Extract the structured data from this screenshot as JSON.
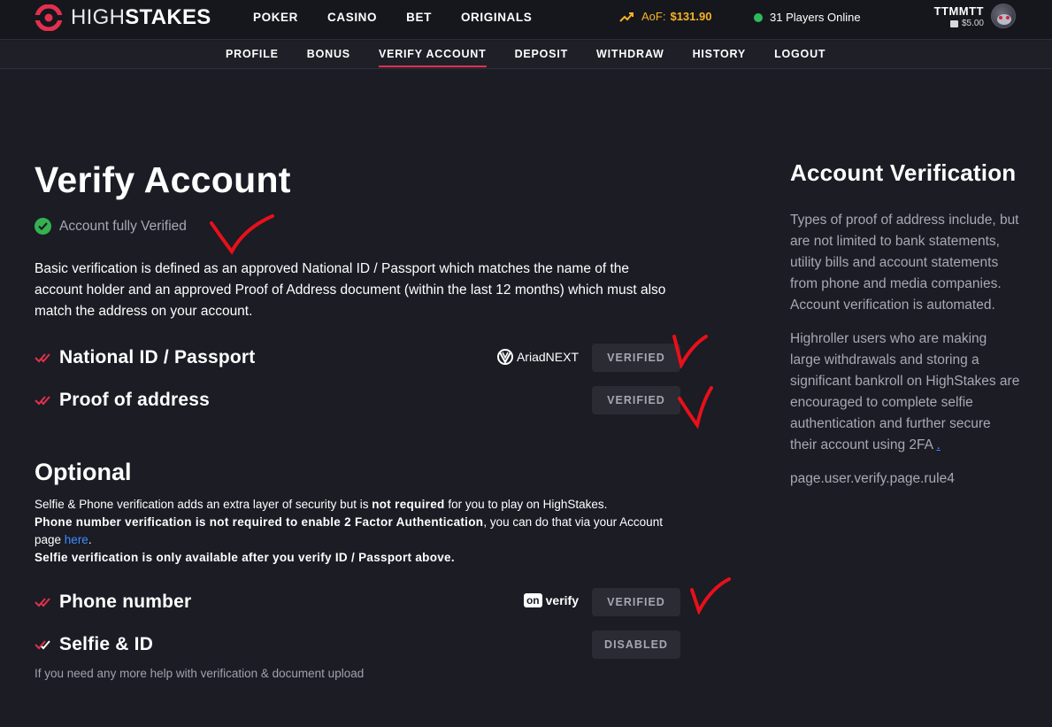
{
  "header": {
    "logo": {
      "light": "HIGH",
      "bold": "STAKES"
    },
    "nav": [
      "POKER",
      "CASINO",
      "BET",
      "ORIGINALS"
    ],
    "aof_label": "AoF:",
    "aof_amount": "$131.90",
    "players_online": "31 Players Online",
    "username": "TTMMTT",
    "balance": "$5.00"
  },
  "subnav": {
    "items": [
      "PROFILE",
      "BONUS",
      "VERIFY ACCOUNT",
      "DEPOSIT",
      "WITHDRAW",
      "HISTORY",
      "LOGOUT"
    ],
    "active": "VERIFY ACCOUNT"
  },
  "main": {
    "title": "Verify Account",
    "status": "Account fully Verified",
    "intro": "Basic verification is defined as an approved National ID / Passport which matches the name of the account holder and an approved Proof of Address document (within the last 12 months) which must also match the address on your account.",
    "requirements": [
      {
        "label": "National ID / Passport",
        "provider": "AriadNEXT",
        "status": "VERIFIED"
      },
      {
        "label": "Proof of address",
        "provider": "",
        "status": "VERIFIED"
      }
    ],
    "optional": {
      "title": "Optional",
      "line1_pre": "Selfie & Phone verification adds an extra layer of security but is ",
      "line1_bold": "not required",
      "line1_post": " for you to play on HighStakes.",
      "line2_bold": "Phone number verification is not required to enable 2 Factor Authentication",
      "line2_post": ", you can do that via your Account page ",
      "line2_link": "here",
      "line2_end": ".",
      "line3_bold": "Selfie verification is only available after you verify ID / Passport above.",
      "items": [
        {
          "label": "Phone number",
          "provider_badge": "on",
          "provider_text": "verify",
          "status": "VERIFIED"
        },
        {
          "label": "Selfie & ID",
          "status": "DISABLED"
        }
      ]
    },
    "help": "If you need any more help with verification & document upload"
  },
  "side": {
    "title": "Account Verification",
    "p1": "Types of proof of address include, but are not limited to bank statements, utility bills and account statements from phone and media companies. Account verification is automated.",
    "p2": "Highroller users who are making large withdrawals and storing a significant bankroll on HighStakes are encouraged to complete selfie authentication and further secure their account using 2FA",
    "p2_link": ".",
    "p3": "page.user.verify.page.rule4"
  },
  "colors": {
    "background": "#1b1c24",
    "accent_red": "#e2304e",
    "gold": "#f5b323",
    "green": "#34b24f",
    "link_blue": "#3d8bff",
    "annotation_red": "#e8101a"
  },
  "icons": [
    "logo-icon",
    "trend-up-icon",
    "online-dot-icon",
    "coin-icon",
    "check-circle-icon",
    "double-check-icon",
    "ariadnext-logo-icon",
    "onverify-logo-icon"
  ]
}
